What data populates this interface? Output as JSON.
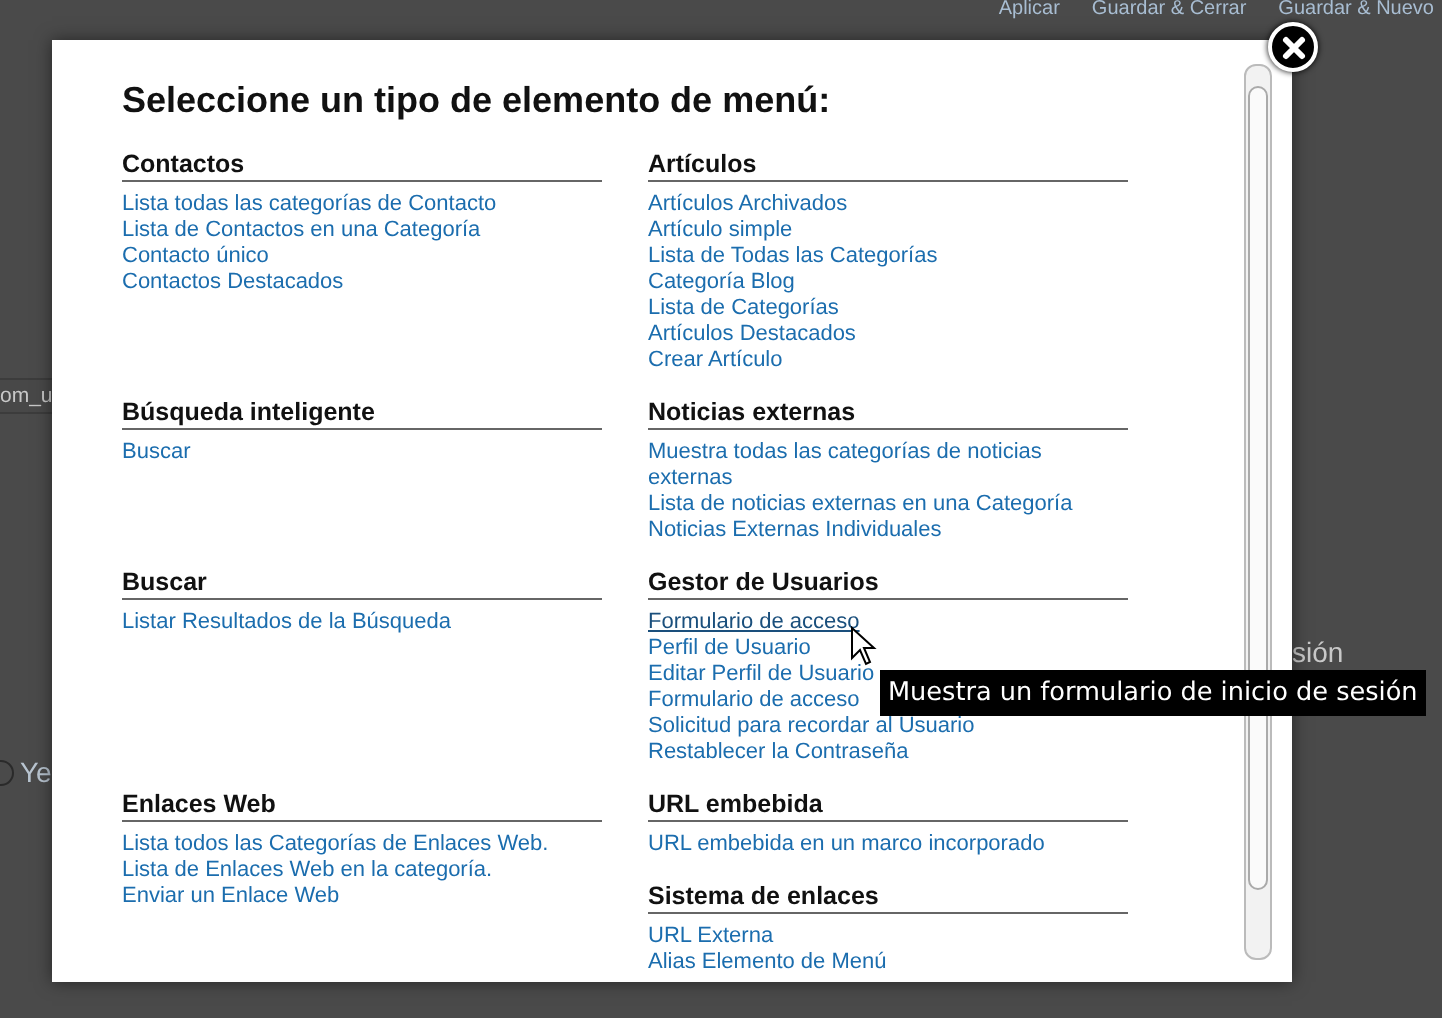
{
  "backdrop": {
    "toolbar": [
      "Aplicar",
      "Guardar & Cerrar",
      "Guardar & Nuevo"
    ],
    "field_fragment": "om_u",
    "radio": {
      "label": "Ye",
      "checked": false
    },
    "text_fragment": "sión"
  },
  "modal": {
    "title": "Seleccione un tipo de elemento de menú:",
    "rows": [
      {
        "left": [
          {
            "heading": "Contactos",
            "links": [
              {
                "label": "Lista todas las categorías de Contacto",
                "hovered": false
              },
              {
                "label": "Lista de Contactos en una Categoría",
                "hovered": false
              },
              {
                "label": "Contacto único",
                "hovered": false
              },
              {
                "label": "Contactos Destacados",
                "hovered": false
              }
            ]
          }
        ],
        "right": [
          {
            "heading": "Artículos",
            "links": [
              {
                "label": "Artículos Archivados",
                "hovered": false
              },
              {
                "label": "Artículo simple",
                "hovered": false
              },
              {
                "label": "Lista de Todas las Categorías",
                "hovered": false
              },
              {
                "label": "Categoría Blog",
                "hovered": false
              },
              {
                "label": "Lista de Categorías",
                "hovered": false
              },
              {
                "label": "Artículos Destacados",
                "hovered": false
              },
              {
                "label": "Crear Artículo",
                "hovered": false
              }
            ]
          }
        ]
      },
      {
        "left": [
          {
            "heading": "Búsqueda inteligente",
            "links": [
              {
                "label": "Buscar",
                "hovered": false
              }
            ]
          }
        ],
        "right": [
          {
            "heading": "Noticias externas",
            "links": [
              {
                "label": "Muestra todas las categorías de noticias externas",
                "hovered": false
              },
              {
                "label": "Lista de noticias externas en una Categoría",
                "hovered": false
              },
              {
                "label": "Noticias Externas Individuales",
                "hovered": false
              }
            ]
          }
        ]
      },
      {
        "left": [
          {
            "heading": "Buscar",
            "links": [
              {
                "label": "Listar Resultados de la Búsqueda",
                "hovered": false
              }
            ]
          }
        ],
        "right": [
          {
            "heading": "Gestor de Usuarios",
            "links": [
              {
                "label": "Formulario de acceso",
                "hovered": true
              },
              {
                "label": "Perfil de Usuario",
                "hovered": false
              },
              {
                "label": "Editar Perfil de Usuario",
                "hovered": false
              },
              {
                "label": "Formulario de acceso",
                "hovered": false
              },
              {
                "label": "Solicitud para recordar al Usuario",
                "hovered": false
              },
              {
                "label": "Restablecer la Contraseña",
                "hovered": false
              }
            ]
          }
        ]
      },
      {
        "left": [
          {
            "heading": "Enlaces Web",
            "links": [
              {
                "label": "Lista todos las Categorías de Enlaces Web.",
                "hovered": false
              },
              {
                "label": "Lista de Enlaces Web en la categoría.",
                "hovered": false
              },
              {
                "label": "Enviar un Enlace Web",
                "hovered": false
              }
            ]
          }
        ],
        "right": [
          {
            "heading": "URL embebida",
            "links": [
              {
                "label": "URL embebida en un marco incorporado",
                "hovered": false
              }
            ]
          },
          {
            "heading": "Sistema de enlaces",
            "links": [
              {
                "label": "URL Externa",
                "hovered": false
              },
              {
                "label": "Alias Elemento de Menú",
                "hovered": false
              }
            ]
          }
        ]
      }
    ]
  },
  "tooltip": "Muestra un formulario de inicio de sesión"
}
